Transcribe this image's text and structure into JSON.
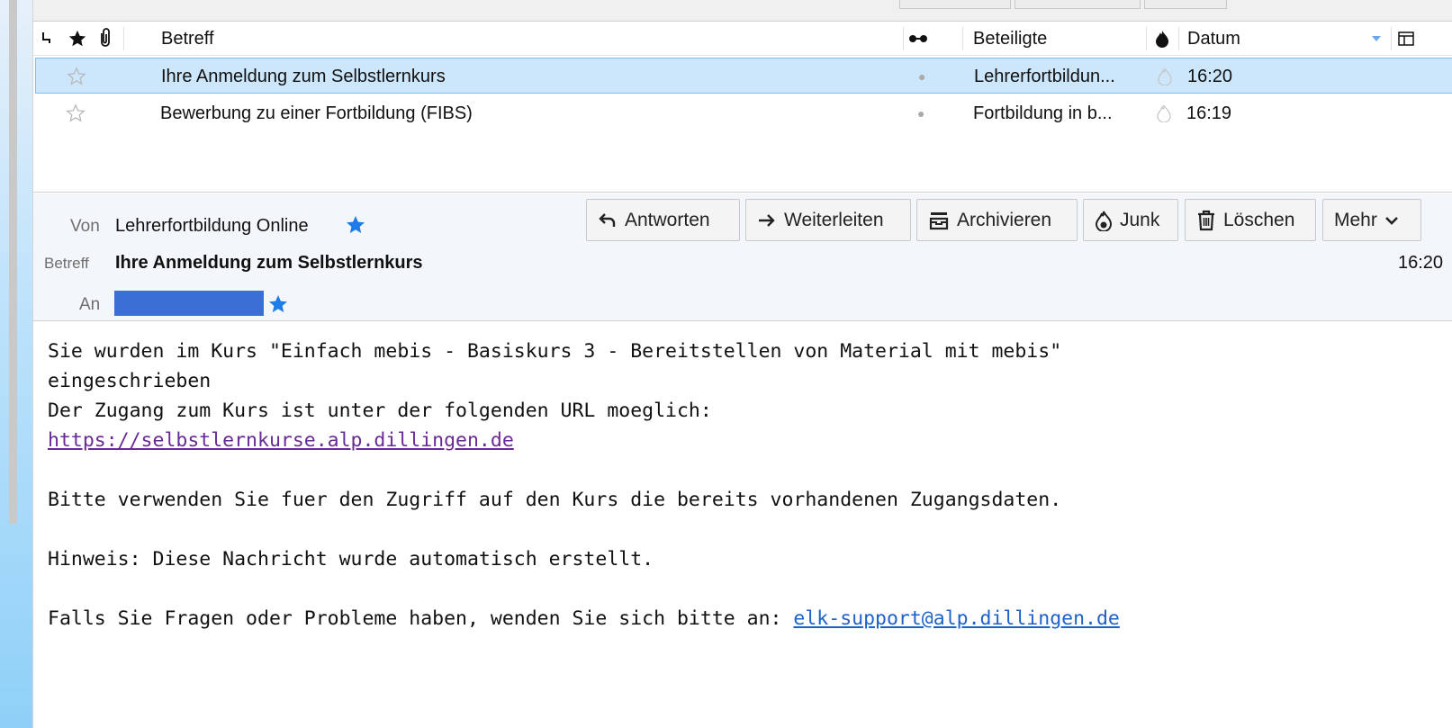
{
  "columns": {
    "subject": "Betreff",
    "participants": "Beteiligte",
    "date": "Datum"
  },
  "messages": [
    {
      "subject": "Ihre Anmeldung zum Selbstlernkurs",
      "participants": "Lehrerfortbildun...",
      "time": "16:20",
      "selected": true
    },
    {
      "subject": "Bewerbung zu einer Fortbildung (FIBS)",
      "participants": "Fortbildung in b...",
      "time": "16:19",
      "selected": false
    }
  ],
  "header": {
    "from_label": "Von",
    "from_value": "Lehrerfortbildung Online",
    "subject_label": "Betreff",
    "subject_value": "Ihre Anmeldung zum Selbstlernkurs",
    "to_label": "An",
    "time": "16:20"
  },
  "actions": {
    "reply": "Antworten",
    "forward": "Weiterleiten",
    "archive": "Archivieren",
    "junk": "Junk",
    "delete": "Löschen",
    "more": "Mehr"
  },
  "body": {
    "line1": "Sie wurden im Kurs \"Einfach mebis - Basiskurs 3 - Bereitstellen von Material mit mebis\"",
    "line2": "eingeschrieben",
    "line3": "Der Zugang zum Kurs ist unter der folgenden URL moeglich:",
    "url": "https://selbstlernkurse.alp.dillingen.de",
    "line5": "Bitte verwenden Sie fuer den Zugriff auf den Kurs die bereits vorhandenen Zugangsdaten.",
    "line6": "Hinweis: Diese Nachricht wurde automatisch erstellt.",
    "line7_prefix": "Falls Sie Fragen oder Probleme haben, wenden Sie sich bitte an: ",
    "support_email": "elk-support@alp.dillingen.de"
  },
  "colors": {
    "selection": "#cce6fc",
    "star_blue": "#1e7ce8",
    "redaction": "#3b6fd6"
  }
}
